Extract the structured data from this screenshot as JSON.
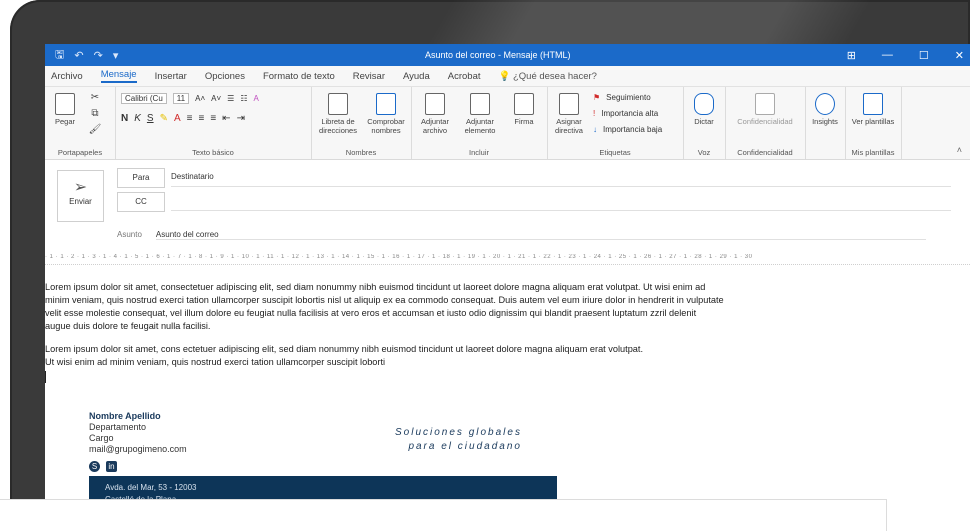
{
  "window": {
    "title": "Asunto del correo  -  Mensaje (HTML)",
    "controls": [
      "⊞",
      "—",
      "☐",
      "✕"
    ]
  },
  "menu": {
    "items": [
      "Archivo",
      "Mensaje",
      "Insertar",
      "Opciones",
      "Formato de texto",
      "Revisar",
      "Ayuda",
      "Acrobat"
    ],
    "active": "Mensaje",
    "tell_me": "¿Qué desea hacer?"
  },
  "ribbon": {
    "paste": "Pegar",
    "font_name": "Calibri (Cu",
    "font_size": "11",
    "groups": {
      "clipboard": "Portapapeles",
      "basic_text": "Texto básico",
      "names": "Nombres",
      "include": "Incluir",
      "tags": "Etiquetas",
      "voice": "Voz",
      "confidentiality": "Confidencialidad",
      "my_templates": "Mis plantillas"
    },
    "buttons": {
      "address_book": "Libreta de direcciones",
      "check_names": "Comprobar nombres",
      "attach_file": "Adjuntar archivo",
      "attach_item": "Adjuntar elemento",
      "signature": "Firma",
      "assign_policy": "Asignar directiva",
      "follow_up": "Seguimiento",
      "high_importance": "Importancia alta",
      "low_importance": "Importancia baja",
      "dictate": "Dictar",
      "confidentiality": "Confidencialidad",
      "insights": "Insights",
      "view_templates": "Ver plantillas"
    }
  },
  "header": {
    "send": "Enviar",
    "to_label": "Para",
    "to_value": "Destinatario",
    "cc_label": "CC",
    "subject_label": "Asunto",
    "subject_value": "Asunto del correo"
  },
  "ruler_text": "· 1 · 1 · 2 · 1 · 3 · 1 · 4 · 1 · 5 · 1 · 6 · 1 · 7 · 1 · 8 · 1 · 9 · 1 · 10 · 1 · 11 · 1 · 12 · 1 · 13 · 1 · 14 · 1 · 15 · 1 · 16 · 1 · 17 · 1 · 18 · 1 · 19 · 1 · 20 · 1 · 21 · 1 · 22 · 1 · 23 · 1 · 24 · 1 · 25 · 1 · 26 · 1 · 27 · 1 · 28 · 1 · 29 · 1 · 30",
  "body": {
    "p1_l1": "Lorem ipsum dolor sit amet, consectetuer adipiscing elit, sed diam nonummy nibh euismod tincidunt ut laoreet dolore magna aliquam erat volutpat. Ut wisi enim ad",
    "p1_l2": "minim veniam, quis nostrud exerci tation ullamcorper suscipit lobortis nisl ut aliquip ex ea commodo consequat. Duis autem vel eum iriure dolor in hendrerit in vulputate",
    "p1_l3": " velit esse molestie  consequat, vel illum dolore eu feugiat nulla facilisis at vero eros et accumsan et iusto odio dignissim qui blandit praesent luptatum zzril delenit",
    "p1_l4": "augue duis dolore te feugait nulla facilisi.",
    "p2_l1": "Lorem ipsum dolor sit amet, cons ectetuer adipiscing elit, sed diam nonummy nibh euismod tincidunt ut laoreet dolore magna aliquam erat volutpat.",
    "p2_l2": "Ut wisi enim ad minim veniam, quis nostrud exerci tation ullamcorper suscipit loborti"
  },
  "signature": {
    "name": "Nombre Apellido",
    "department": "Departamento",
    "role": "Cargo",
    "email": "mail@grupogimeno.com",
    "slogan_l1": "Soluciones globales",
    "slogan_l2": "para el ciudadano",
    "address_l1": "Avda. del Mar, 53 - 12003",
    "address_l2": "Castelló de la Plana"
  },
  "colors": {
    "titlebar": "#1b6ac9",
    "brand_navy": "#0d3558",
    "accent_text": "#1a3a5c"
  }
}
